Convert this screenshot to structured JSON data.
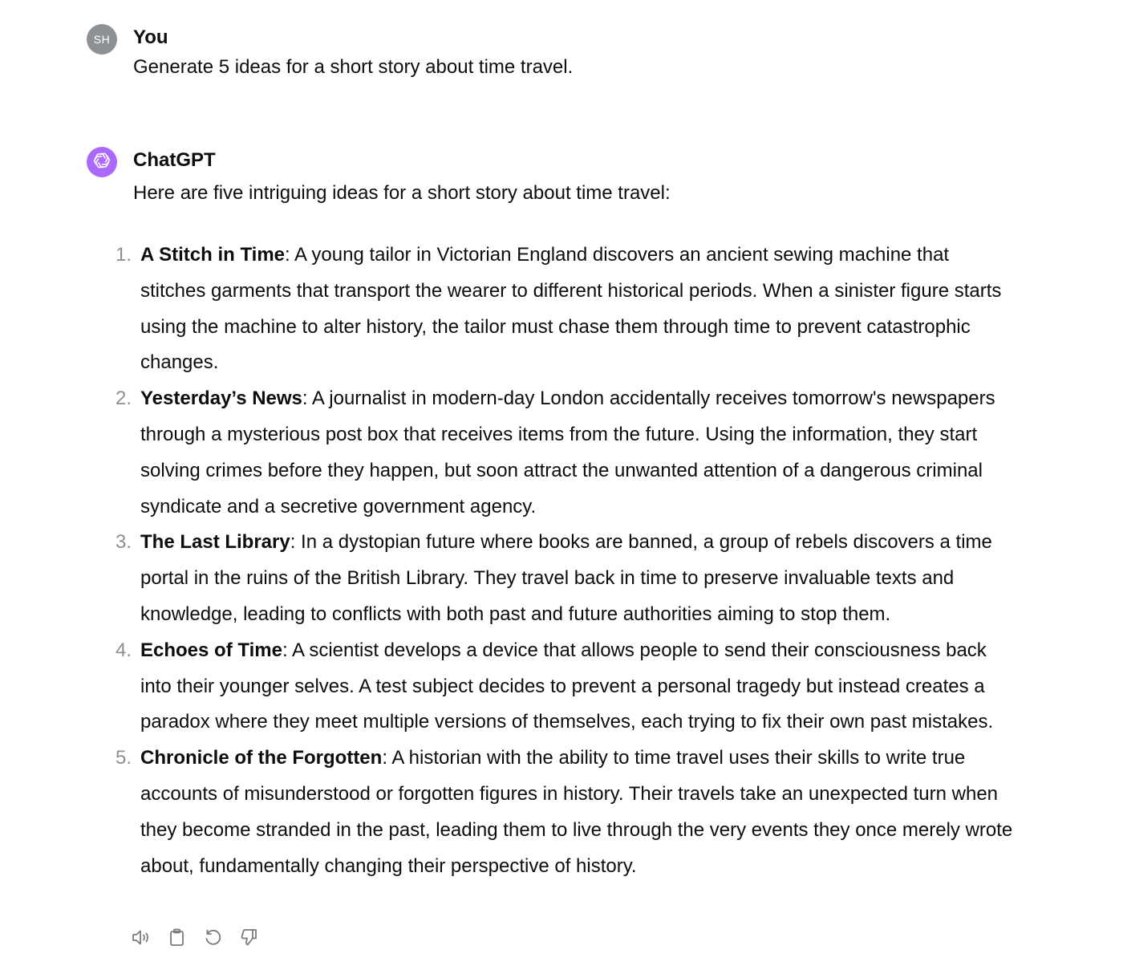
{
  "user_message": {
    "avatar_initials": "SH",
    "author": "You",
    "text": "Generate 5 ideas for a short story about time travel."
  },
  "assistant_message": {
    "author": "ChatGPT",
    "avatar_icon": "openai-logo-icon",
    "intro": "Here are five intriguing ideas for a short story about time travel:",
    "ideas": [
      {
        "number": "1.",
        "title": "A Stitch in Time",
        "body": ": A young tailor in Victorian England discovers an ancient sewing machine that stitches garments that transport the wearer to different historical periods. When a sinister figure starts using the machine to alter history, the tailor must chase them through time to prevent catastrophic changes."
      },
      {
        "number": "2.",
        "title": "Yesterday’s News",
        "body": ": A journalist in modern-day London accidentally receives tomorrow's newspapers through a mysterious post box that receives items from the future. Using the information, they start solving crimes before they happen, but soon attract the unwanted attention of a dangerous criminal syndicate and a secretive government agency."
      },
      {
        "number": "3.",
        "title": "The Last Library",
        "body": ": In a dystopian future where books are banned, a group of rebels discovers a time portal in the ruins of the British Library. They travel back in time to preserve invaluable texts and knowledge, leading to conflicts with both past and future authorities aiming to stop them."
      },
      {
        "number": "4.",
        "title": "Echoes of Time",
        "body": ": A scientist develops a device that allows people to send their consciousness back into their younger selves. A test subject decides to prevent a personal tragedy but instead creates a paradox where they meet multiple versions of themselves, each trying to fix their own past mistakes."
      },
      {
        "number": "5.",
        "title": "Chronicle of the Forgotten",
        "body": ": A historian with the ability to time travel uses their skills to write true accounts of misunderstood or forgotten figures in history. Their travels take an unexpected turn when they become stranded in the past, leading them to live through the very events they once merely wrote about, fundamentally changing their perspective of history."
      }
    ]
  },
  "actions": [
    "speaker-icon",
    "clipboard-icon",
    "regenerate-icon",
    "thumbs-down-icon"
  ],
  "colors": {
    "text": "#0d0d0d",
    "list_number": "#8e8e8e",
    "user_avatar_bg": "#8e9193",
    "bot_avatar_bg": "#ab68ff",
    "icon_gray": "#7a7a7a"
  }
}
